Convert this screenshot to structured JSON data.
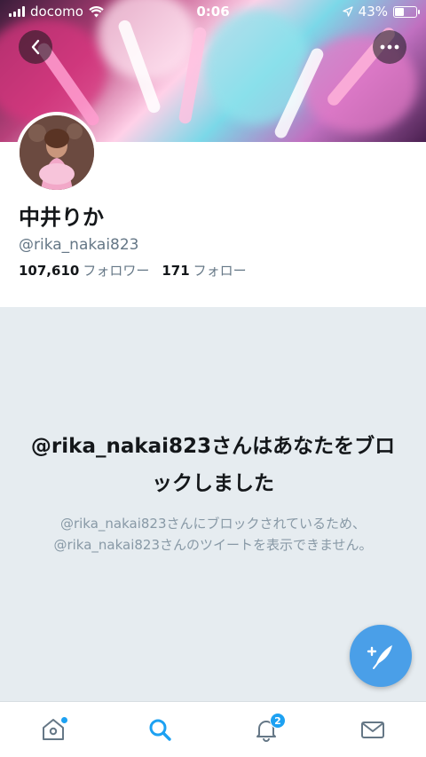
{
  "status_bar": {
    "carrier": "docomo",
    "time": "0:06",
    "battery_percent": "43%",
    "battery_level": 0.43
  },
  "profile": {
    "display_name": "中井りか",
    "handle": "@rika_nakai823",
    "followers_count": "107,610",
    "followers_label": "フォロワー",
    "following_count": "171",
    "following_label": "フォロー"
  },
  "blocked": {
    "title": "@rika_nakai823さんはあなたをブロックしました",
    "description": "@rika_nakai823さんにブロックされているため、@rika_nakai823さんのツイートを表示できません。"
  },
  "tab_bar": {
    "notifications_badge": "2",
    "tabs": [
      "home",
      "search",
      "notifications",
      "messages"
    ],
    "active_tab": "search"
  },
  "colors": {
    "accent": "#1da1f2",
    "fab": "#4a9fe8",
    "blocked_bg": "#e6ecf0",
    "secondary_text": "#657786"
  },
  "icons": {
    "back": "chevron-left-icon",
    "more": "more-horizontal-icon",
    "compose": "compose-tweet-icon",
    "home": "home-icon",
    "search": "search-icon",
    "notifications": "bell-icon",
    "messages": "mail-icon"
  }
}
